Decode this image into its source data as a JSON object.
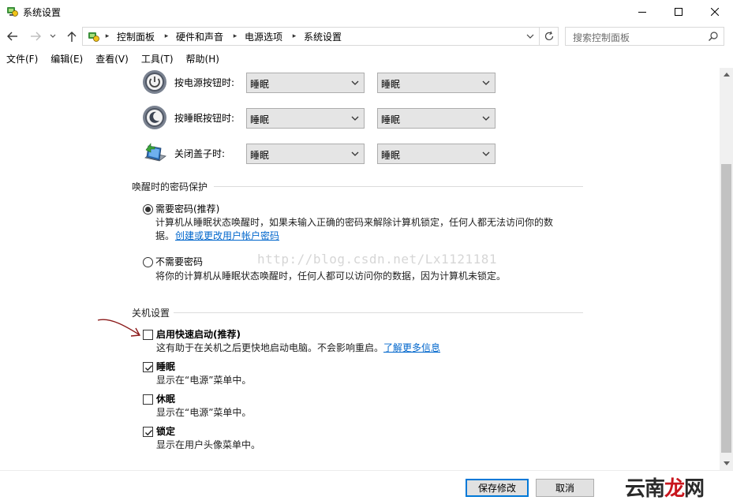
{
  "window": {
    "title": "系统设置"
  },
  "nav": {
    "breadcrumbs": [
      "控制面板",
      "硬件和声音",
      "电源选项",
      "系统设置"
    ],
    "search_placeholder": "搜索控制面板"
  },
  "menu": [
    "文件(F)",
    "编辑(E)",
    "查看(V)",
    "工具(T)",
    "帮助(H)"
  ],
  "power_buttons": {
    "rows": [
      {
        "label": "按电源按钮时:",
        "icon": "power-button-icon",
        "battery": "睡眠",
        "plugged": "睡眠"
      },
      {
        "label": "按睡眠按钮时:",
        "icon": "sleep-button-icon",
        "battery": "睡眠",
        "plugged": "睡眠"
      },
      {
        "label": "关闭盖子时:",
        "icon": "laptop-lid-icon",
        "battery": "睡眠",
        "plugged": "睡眠"
      }
    ]
  },
  "wake_password": {
    "title": "唤醒时的密码保护",
    "require": {
      "label": "需要密码(推荐)",
      "selected": true,
      "desc_line1": "计算机从睡眠状态唤醒时，如果未输入正确的密码来解除计算机锁定，任何人都无法访问你的数",
      "desc_line2": "据。",
      "link": "创建或更改用户帐户密码"
    },
    "no_require": {
      "label": "不需要密码",
      "selected": false,
      "desc": "将你的计算机从睡眠状态唤醒时，任何人都可以访问你的数据，因为计算机未锁定。"
    }
  },
  "shutdown": {
    "title": "关机设置",
    "options": [
      {
        "label": "启用快速启动(推荐)",
        "checked": false,
        "desc": "这有助于在关机之后更快地启动电脑。不会影响重启。",
        "link": "了解更多信息"
      },
      {
        "label": "睡眠",
        "checked": true,
        "desc": "显示在“电源”菜单中。"
      },
      {
        "label": "休眠",
        "checked": false,
        "desc": "显示在“电源”菜单中。"
      },
      {
        "label": "锁定",
        "checked": true,
        "desc": "显示在用户头像菜单中。"
      }
    ]
  },
  "watermark": "http://blog.csdn.net/Lx1121181",
  "footer": {
    "save_label": "保存修改",
    "cancel_label": "取消",
    "logo_part1": "云南",
    "logo_part2": "龙",
    "logo_part3": "网"
  },
  "colors": {
    "link": "#0066cc",
    "accent": "#0078d7",
    "logo_red": "#c8151d",
    "annotation_arrow": "#8b1a1a"
  }
}
